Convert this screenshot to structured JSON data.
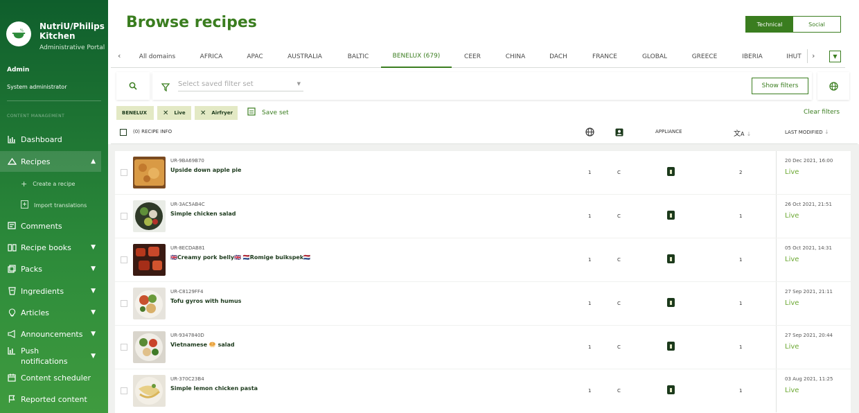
{
  "sidebar": {
    "brand": "NutriU/Philips Kitchen",
    "brand_sub": "Administrative Portal",
    "user_name": "Admin",
    "user_role": "System administrator",
    "section_label": "CONTENT MANAGEMENT",
    "items": [
      {
        "label": "Dashboard",
        "icon": "chart-icon"
      },
      {
        "label": "Recipes",
        "icon": "recipe-icon"
      },
      {
        "label": "Create a recipe",
        "icon": "plus-icon"
      },
      {
        "label": "Import translations",
        "icon": "import-icon"
      },
      {
        "label": "Comments",
        "icon": "comments-icon"
      },
      {
        "label": "Recipe books",
        "icon": "book-icon"
      },
      {
        "label": "Packs",
        "icon": "packs-icon"
      },
      {
        "label": "Ingredients",
        "icon": "ingredients-icon"
      },
      {
        "label": "Articles",
        "icon": "articles-icon"
      },
      {
        "label": "Announcements",
        "icon": "megaphone-icon"
      },
      {
        "label": "Push notifications",
        "icon": "push-icon"
      },
      {
        "label": "Content scheduler",
        "icon": "calendar-icon"
      },
      {
        "label": "Reported content",
        "icon": "flag-icon"
      }
    ]
  },
  "header": {
    "title": "Browse recipes",
    "toggle": [
      "Technical",
      "Social"
    ],
    "toggle_selected": "Technical"
  },
  "tabs": [
    "All domains",
    "AFRICA",
    "APAC",
    "AUSTRALIA",
    "BALTIC",
    "BENELUX (679)",
    "CEER",
    "CHINA",
    "DACH",
    "FRANCE",
    "GLOBAL",
    "GREECE",
    "IBERIA",
    "IHUT"
  ],
  "active_tab": "BENELUX (679)",
  "filters": {
    "placeholder": "Select saved filter set",
    "show_filters": "Show filters",
    "chips": [
      "BENELUX",
      "Live",
      "Airfryer"
    ],
    "save_set": "Save set",
    "clear_filters": "Clear filters"
  },
  "table": {
    "recipe_info_header": "(0) RECIPE INFO",
    "appliance_header": "APPLIANCE",
    "last_modified_header": "LAST MODIFIED",
    "rows": [
      {
        "id": "UR-9BA69B70",
        "name": "Upside down apple pie",
        "lang": "1",
        "type": "C",
        "translations": "2",
        "modified": "20 Dec 2021, 16:00",
        "status": "Live"
      },
      {
        "id": "UR-3AC5AB4C",
        "name": "Simple chicken salad",
        "lang": "1",
        "type": "C",
        "translations": "1",
        "modified": "26 Oct 2021, 21:51",
        "status": "Live"
      },
      {
        "id": "UR-8ECDAB81",
        "name": "🇬🇧Creamy pork belly🇬🇧 🇳🇱Romige buikspek🇳🇱",
        "lang": "1",
        "type": "C",
        "translations": "1",
        "modified": "05 Oct 2021, 14:31",
        "status": "Live"
      },
      {
        "id": "UR-C8129FF4",
        "name": "Tofu gyros with humus",
        "lang": "1",
        "type": "C",
        "translations": "1",
        "modified": "27 Sep 2021, 21:11",
        "status": "Live"
      },
      {
        "id": "UR-9347840D",
        "name": "Vietnamese 🥯 salad",
        "lang": "1",
        "type": "C",
        "translations": "1",
        "modified": "27 Sep 2021, 20:44",
        "status": "Live"
      },
      {
        "id": "UR-370C23B4",
        "name": "Simple lemon chicken pasta",
        "lang": "1",
        "type": "C",
        "translations": "1",
        "modified": "03 Aug 2021, 11:25",
        "status": "Live"
      }
    ]
  }
}
